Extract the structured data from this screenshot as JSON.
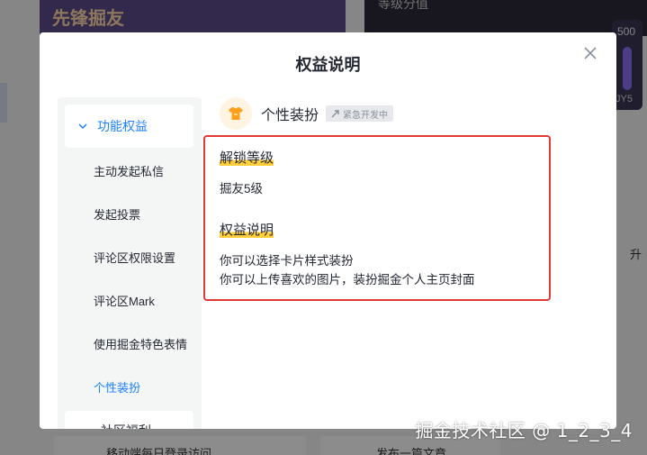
{
  "background": {
    "banner_text": "先锋掘友",
    "right_title": "等级分值",
    "level_number": "500",
    "level_tag": "JY5",
    "right_item": "升",
    "bottom_left_text": "移动端每日登录访问",
    "bottom_right_text": "发布一篇文章"
  },
  "modal": {
    "title": "权益说明",
    "sidebar": {
      "group_label": "功能权益",
      "items": [
        {
          "label": "主动发起私信"
        },
        {
          "label": "发起投票"
        },
        {
          "label": "评论区权限设置"
        },
        {
          "label": "评论区Mark"
        },
        {
          "label": "使用掘金特色表情"
        },
        {
          "label": "个性装扮"
        }
      ],
      "active_index": 5,
      "next_group_label": "社区福利"
    },
    "feature": {
      "name": "个性装扮",
      "badge": "紧急开发中",
      "unlock_title": "解锁等级",
      "unlock_value": "掘友5级",
      "benefit_title": "权益说明",
      "benefit_lines": [
        "你可以选择卡片样式装扮",
        "你可以上传喜欢的图片，装扮掘金个人主页封面"
      ]
    }
  },
  "watermark": "掘金技术社区 @ 1_2_3_4",
  "colors": {
    "accent": "#1e80ff",
    "highlight_border": "#e53935",
    "underline_highlight": "#ffce3a"
  }
}
